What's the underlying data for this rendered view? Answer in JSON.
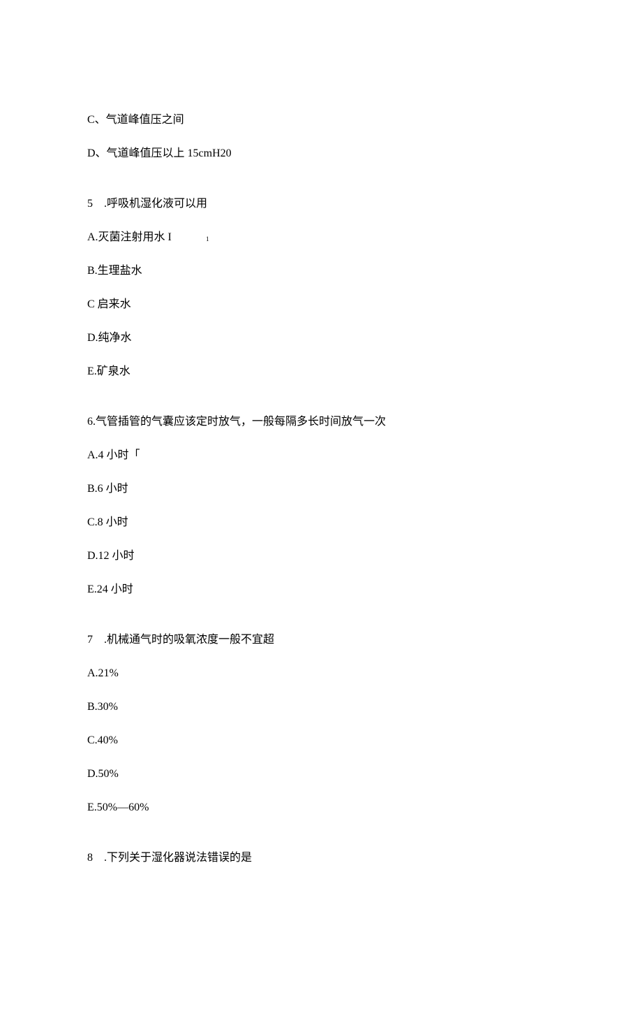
{
  "remainder": {
    "optC": "C、气道峰值压之间",
    "optD": "D、气道峰值压以上 15cmH20"
  },
  "q5": {
    "stem": "5 .呼吸机湿化液可以用",
    "optA": "A.灭菌注射用水 I",
    "noteA": "1",
    "optB": "B.生理盐水",
    "optC": "C 启来水",
    "optD": "D.纯净水",
    "optE": "E.矿泉水"
  },
  "q6": {
    "stem": "6.气管插管的气囊应该定时放气，一般每隔多长时间放气一次",
    "optA": "A.4 小时「",
    "optB": "B.6 小时",
    "optC": "C.8 小时",
    "optD": "D.12 小时",
    "optE": "E.24 小时"
  },
  "q7": {
    "stem": "7 .机械通气时的吸氧浓度一般不宜超",
    "optA": "A.21%",
    "optB": "B.30%",
    "optC": "C.40%",
    "optD": "D.50%",
    "optE": "E.50%—60%"
  },
  "q8": {
    "stem": "8 .下列关于湿化器说法错误的是"
  }
}
